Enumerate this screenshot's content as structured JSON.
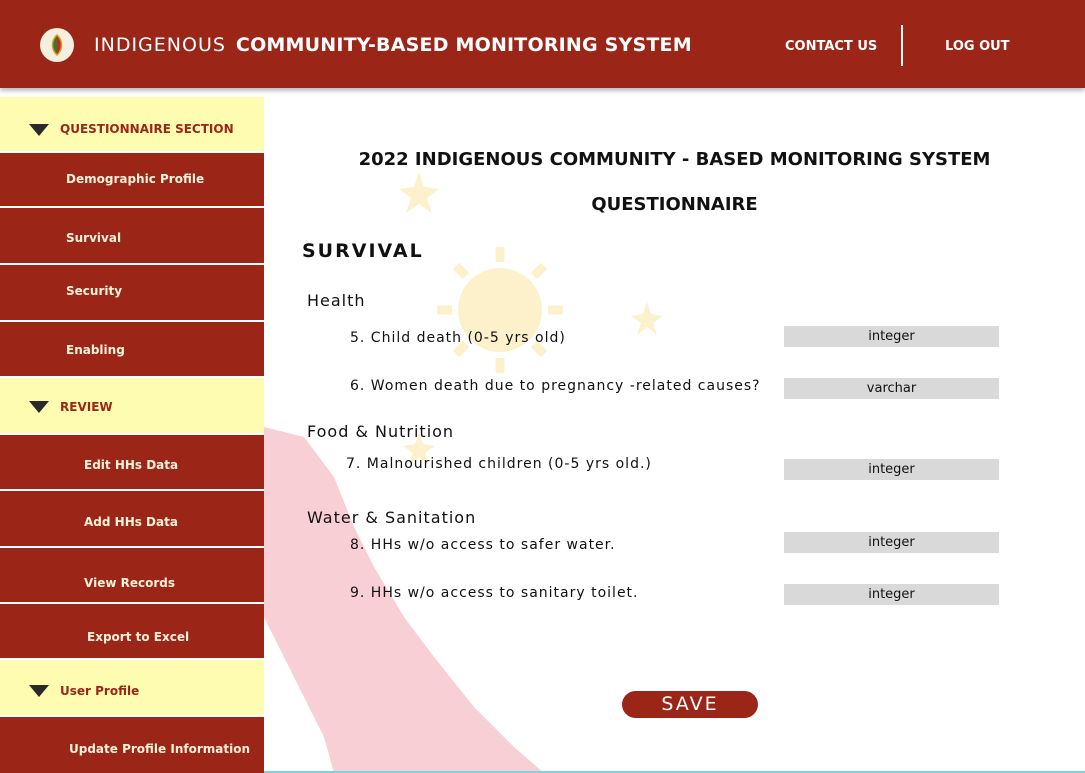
{
  "header": {
    "brand_first": "INDIGENOUS",
    "brand_rest": "COMMUNITY-BASED MONITORING SYSTEM",
    "contact_label": "CONTACT US",
    "logout_label": "LOG OUT"
  },
  "sidebar": {
    "questionnaire_section": "QUESTIONNAIRE SECTION",
    "demographic": "Demographic Profile",
    "survival": "Survival",
    "security": "Security",
    "enabling": "Enabling",
    "review_section": "REVIEW",
    "edit_hhs": "Edit HHs Data",
    "add_hhs": "Add HHs Data",
    "view_records": "View Records",
    "export": "Export to Excel",
    "user_profile_section": "User Profile",
    "update_profile": "Update Profile Information"
  },
  "main": {
    "title_line1": "2022 INDIGENOUS COMMUNITY - BASED MONITORING SYSTEM",
    "title_line2": "QUESTIONNAIRE",
    "section": "SURVIVAL",
    "health": "Health",
    "food": "Food & Nutrition",
    "water": "Water & Sanitation",
    "q5": "5. Child death (0-5 yrs old)",
    "q6": "6. Women death due to pregnancy -related causes?",
    "q7": "7. Malnourished children (0-5 yrs old.)",
    "q8": "8.  HHs w/o access to safer water.",
    "q9": "9.  HHs w/o access to sanitary toilet.",
    "q5_value": "integer",
    "q6_value": "varchar",
    "q7_value": "integer",
    "q8_value": "integer",
    "q9_value": "integer",
    "save_label": "SAVE"
  },
  "colors": {
    "brand_red": "#9b2618",
    "section_yellow": "#fdfcb1",
    "field_gray": "#d9d9d9"
  }
}
